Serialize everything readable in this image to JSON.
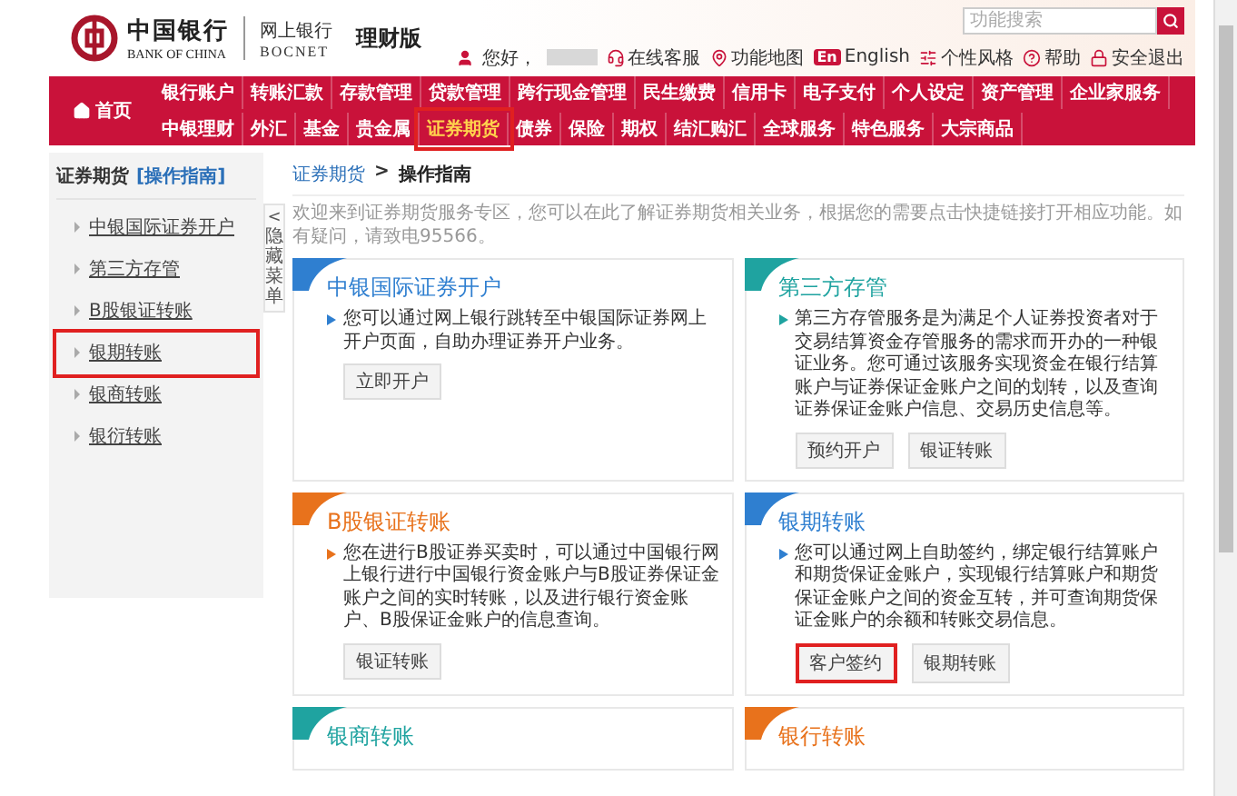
{
  "header": {
    "logo_name": "中国银行",
    "logo_en": "BANK OF CHINA",
    "product": "网上银行",
    "product_en": "BOCNET",
    "edition": "理财版",
    "search": {
      "placeholder": "功能搜索"
    },
    "greeting": "您好，",
    "links": [
      {
        "kind": "support",
        "label": "在线客服"
      },
      {
        "kind": "map",
        "label": "功能地图"
      },
      {
        "kind": "lang",
        "badge": "En",
        "label": "English"
      },
      {
        "kind": "style",
        "label": "个性风格"
      },
      {
        "kind": "help",
        "label": "帮助"
      },
      {
        "kind": "logout",
        "label": "安全退出"
      }
    ]
  },
  "nav": {
    "home": "首页",
    "upper_items": [
      {
        "label": "银行账户",
        "selected": false
      },
      {
        "label": "转账汇款",
        "selected": false
      },
      {
        "label": "存款管理",
        "selected": false
      },
      {
        "label": "贷款管理",
        "selected": false
      },
      {
        "label": "跨行现金管理",
        "selected": false
      },
      {
        "label": "民生缴费",
        "selected": false
      },
      {
        "label": "信用卡",
        "selected": false
      },
      {
        "label": "电子支付",
        "selected": false
      },
      {
        "label": "个人设定",
        "selected": false
      },
      {
        "label": "资产管理",
        "selected": false
      },
      {
        "label": "企业家服务",
        "selected": false
      }
    ],
    "lower_items": [
      {
        "label": "中银理财",
        "selected": false
      },
      {
        "label": "外汇",
        "selected": false
      },
      {
        "label": "基金",
        "selected": false
      },
      {
        "label": "贵金属",
        "selected": false
      },
      {
        "label": "证券期货",
        "selected": true,
        "highlighted": true
      },
      {
        "label": "债券",
        "selected": false
      },
      {
        "label": "保险",
        "selected": false
      },
      {
        "label": "期权",
        "selected": false
      },
      {
        "label": "结汇购汇",
        "selected": false
      },
      {
        "label": "全球服务",
        "selected": false
      },
      {
        "label": "特色服务",
        "selected": false
      },
      {
        "label": "大宗商品",
        "selected": false
      }
    ]
  },
  "sidebar": {
    "title": "证券期货",
    "guide_link": "[操作指南]",
    "items": [
      {
        "label": "中银国际证券开户",
        "highlighted": false
      },
      {
        "label": "第三方存管",
        "highlighted": false
      },
      {
        "label": "B股银证转账",
        "highlighted": false
      },
      {
        "label": "银期转账",
        "highlighted": true
      },
      {
        "label": "银商转账",
        "highlighted": false
      },
      {
        "label": "银衍转账",
        "highlighted": false
      }
    ]
  },
  "collapse_tab": {
    "arrow": "<",
    "label": "隐藏菜单"
  },
  "breadcrumb": {
    "parent": "证券期货",
    "separator": ">",
    "current": "操作指南"
  },
  "intro": "欢迎来到证券期货服务专区，您可以在此了解证券期货相关业务，根据您的需要点击快捷链接打开相应功能。如有疑问，请致电95566。",
  "cards": [
    {
      "title": "中银国际证券开户",
      "color": "#2f7fd0",
      "description": "您可以通过网上银行跳转至中银国际证券网上开户页面，自助办理证券开户业务。",
      "buttons": [
        {
          "label": "立即开户",
          "highlighted": false
        }
      ]
    },
    {
      "title": "第三方存管",
      "color": "#1fa3a0",
      "description": "第三方存管服务是为满足个人证券投资者对于交易结算资金存管服务的需求而开办的一种银证业务。您可通过该服务实现资金在银行结算账户与证券保证金账户之间的划转，以及查询证券保证金账户信息、交易历史信息等。",
      "buttons": [
        {
          "label": "预约开户",
          "highlighted": false
        },
        {
          "label": "银证转账",
          "highlighted": false
        }
      ]
    },
    {
      "title": "B股银证转账",
      "color": "#e8721c",
      "description": "您在进行B股证券买卖时，可以通过中国银行网上银行进行中国银行资金账户与B股证券保证金账户之间的实时转账，以及进行银行资金账户、B股保证金账户的信息查询。",
      "buttons": [
        {
          "label": "银证转账",
          "highlighted": false
        }
      ]
    },
    {
      "title": "银期转账",
      "color": "#2f7fd0",
      "description": "您可以通过网上自助签约，绑定银行结算账户和期货保证金账户，实现银行结算账户和期货保证金账户之间的资金互转，并可查询期货保证金账户的余额和转账交易信息。",
      "buttons": [
        {
          "label": "客户签约",
          "highlighted": true
        },
        {
          "label": "银期转账",
          "highlighted": false
        }
      ]
    },
    {
      "title": "银商转账",
      "color": "#1fa3a0"
    },
    {
      "title": "银行转账",
      "color": "#e8721c"
    }
  ]
}
